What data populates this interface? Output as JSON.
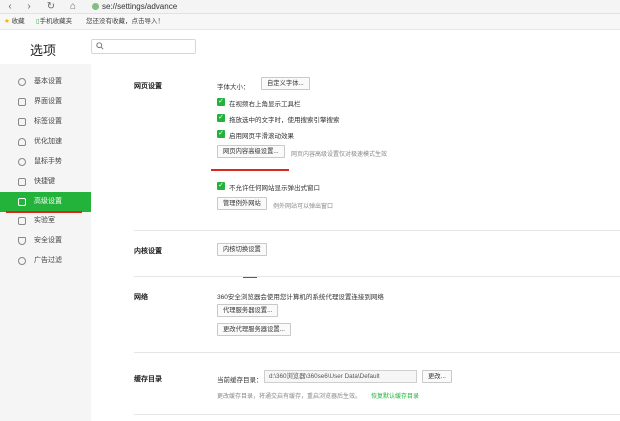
{
  "browser": {
    "url": "se://settings/advance",
    "bookmarks": [
      "收藏",
      "手机收藏夹",
      "您还没有收藏，点击导入！"
    ]
  },
  "header": {
    "title": "选项",
    "search_placeholder": ""
  },
  "sidebar": {
    "items": [
      {
        "label": "基本设置",
        "icon": "gear-icon"
      },
      {
        "label": "界面设置",
        "icon": "window-icon"
      },
      {
        "label": "标签设置",
        "icon": "tab-icon"
      },
      {
        "label": "优化加速",
        "icon": "rocket-icon"
      },
      {
        "label": "鼠标手势",
        "icon": "mouse-icon"
      },
      {
        "label": "快捷键",
        "icon": "keyboard-icon"
      },
      {
        "label": "高级设置",
        "icon": "wrench-icon",
        "active": true
      },
      {
        "label": "实验室",
        "icon": "flask-icon"
      },
      {
        "label": "安全设置",
        "icon": "shield-icon"
      },
      {
        "label": "广告过滤",
        "icon": "block-icon"
      }
    ]
  },
  "web": {
    "title": "网页设置",
    "font_size_label": "字体大小：",
    "custom_font_btn": "自定义字体...",
    "options": [
      "在视频右上角显示工具栏",
      "拖放选中的文字时，使用搜索引擎搜索",
      "启用网页平滑滚动效果"
    ],
    "content_adv_btn": "网页内容高级设置...",
    "content_adv_hint": "网页内容高级设置仅对极速模式生效",
    "popup_option": "不允许任何网站显示弹出式窗口",
    "manage_btn": "管理例外网站",
    "manage_hint": "例外网站可以弹出窗口"
  },
  "kernel": {
    "title": "内核设置",
    "btn": "内核切换设置"
  },
  "network": {
    "title": "网络",
    "desc": "360安全浏览器会使用您计算机的系统代理设置连接到网络",
    "proxy_btn": "代理服务器设置...",
    "change_proxy_btn": "更改代理服务器设置..."
  },
  "cache": {
    "title": "缓存目录",
    "current_label": "当前缓存目录：",
    "path": "d:\\360浏览器\\360se6\\User Data\\Default",
    "change_btn": "更改...",
    "note": "更改缓存目录，将通交启有缓存，重启浏览器后生效。",
    "restore_link": "恢复默认缓存目录"
  },
  "colors": {
    "accent": "#23b23a",
    "highlight_line": "#d9281f"
  }
}
